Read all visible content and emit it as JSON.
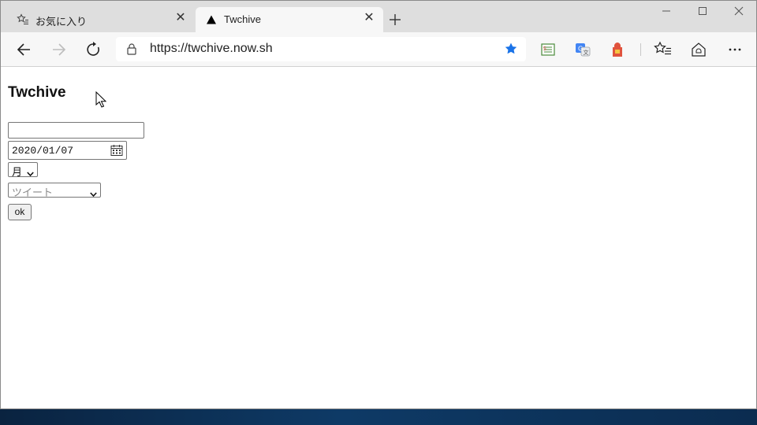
{
  "browser": {
    "tabs": [
      {
        "title": "お気に入り",
        "icon": "favorites-star-icon",
        "active": false
      },
      {
        "title": "Twchive",
        "icon": "triangle-logo-icon",
        "active": true
      }
    ],
    "address": {
      "url": "https://twchive.now.sh"
    },
    "accent_color": "#1a73e8"
  },
  "page": {
    "title": "Twchive",
    "form": {
      "text_value": "",
      "date_value": "2020/01/07",
      "period_select": "月",
      "type_select": "ツイート",
      "submit_label": "ok"
    }
  }
}
